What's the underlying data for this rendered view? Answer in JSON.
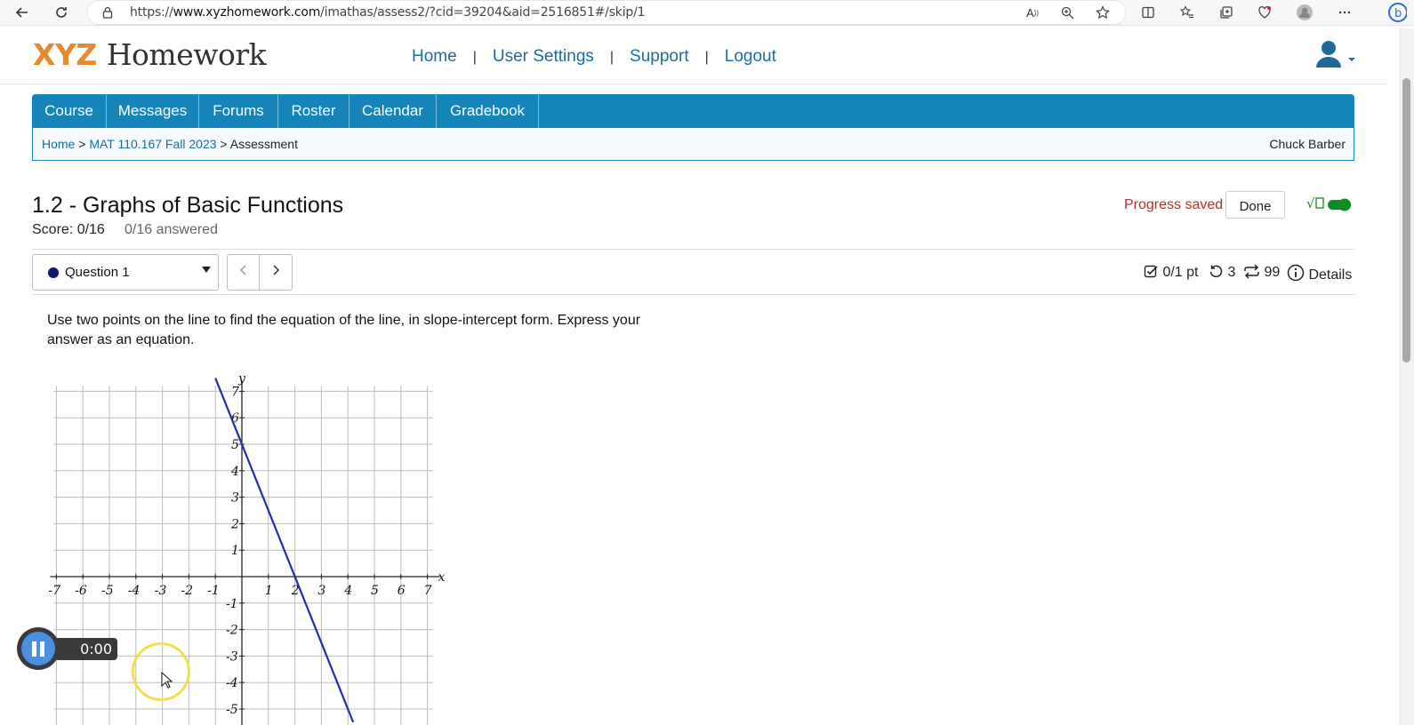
{
  "browser": {
    "url_prefix": "https://",
    "url_host": "www.xyzhomework.com",
    "url_path": "/imathas/assess2/?cid=39204&aid=2516851#/skip/1"
  },
  "header": {
    "logo_brand": "XYZ",
    "logo_word": "Homework",
    "nav": [
      "Home",
      "User Settings",
      "Support",
      "Logout"
    ],
    "separator": "|"
  },
  "tabs": [
    "Course",
    "Messages",
    "Forums",
    "Roster",
    "Calendar",
    "Gradebook"
  ],
  "breadcrumb": {
    "home": "Home",
    "sep": ">",
    "course": "MAT 110.167 Fall 2023",
    "current": "Assessment"
  },
  "user_name": "Chuck Barber",
  "assessment": {
    "title": "1.2 - Graphs of Basic Functions",
    "score": "Score: 0/16",
    "answered": "0/16 answered",
    "progress_saved": "Progress saved",
    "done_label": "Done"
  },
  "question_nav": {
    "selected": "Question 1",
    "points": "0/1 pt",
    "retries": "3",
    "attempts": "99",
    "details": "Details"
  },
  "question": {
    "text": "Use two points on the line to find the equation of the line, in slope-intercept form. Express your answer as an equation."
  },
  "graph": {
    "x_label": "x",
    "y_label": "y",
    "x_ticks": [
      "-7",
      "-6",
      "-5",
      "-4",
      "-3",
      "-2",
      "-1",
      "1",
      "2",
      "3",
      "4",
      "5",
      "6",
      "7"
    ],
    "y_ticks": [
      "7",
      "6",
      "5",
      "4",
      "3",
      "2",
      "1",
      "-1",
      "-2",
      "-3",
      "-4",
      "-5"
    ],
    "line_color": "#1f2fb0",
    "line": {
      "x1": -1,
      "y1": 7.5,
      "x2": 4.2,
      "y2": -5.5
    }
  },
  "recorder": {
    "time": "0:00"
  }
}
